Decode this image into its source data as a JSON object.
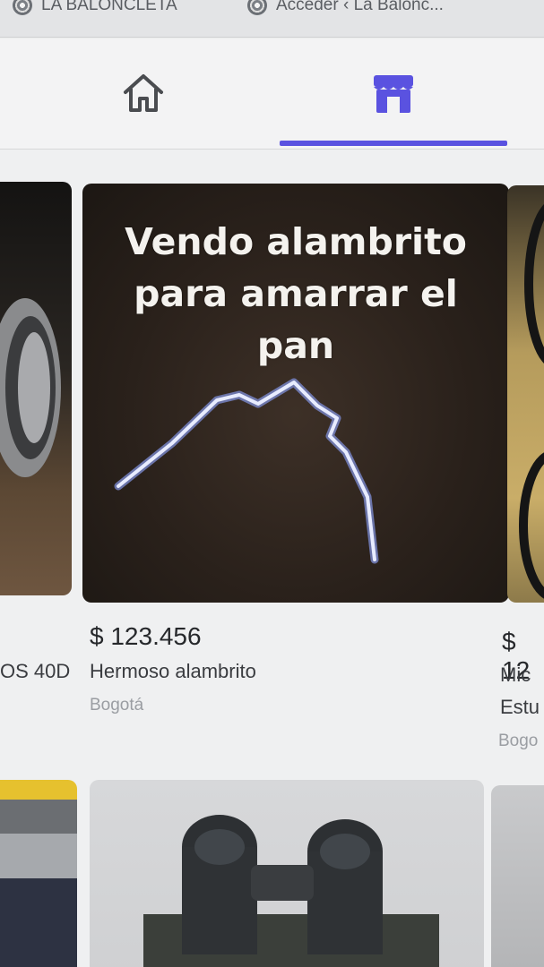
{
  "browser_tabs": [
    {
      "label": "LA BALONCLETA"
    },
    {
      "label": "Acceder ‹ La Balonc..."
    }
  ],
  "nav": {
    "home_icon": "home-icon",
    "marketplace_icon": "storefront-icon",
    "active": "marketplace",
    "accent_color": "#5a52e0"
  },
  "listings": {
    "left": {
      "title_fragment": "OS 40D"
    },
    "main": {
      "image_text": [
        "Vendo alambrito",
        "para amarrar el",
        "pan"
      ],
      "price": "$ 123.456",
      "title": "Hermoso alambrito",
      "location": "Bogotá"
    },
    "right": {
      "price_fragment": "$ 12",
      "title_line1": "Mic",
      "title_line2": "Estu",
      "location_fragment": "Bogo"
    }
  }
}
